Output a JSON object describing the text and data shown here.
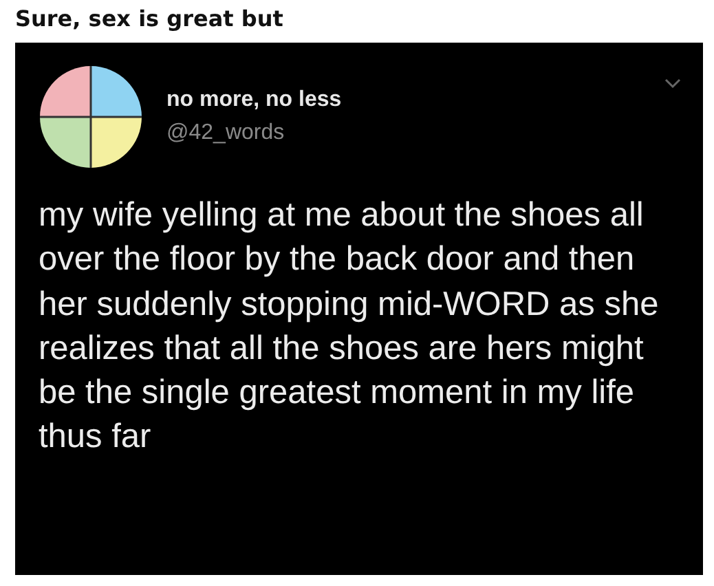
{
  "caption": "Sure, sex is great but",
  "tweet": {
    "display_name": "no more, no less",
    "handle": "@42_words",
    "text": "my wife yelling at me about the shoes all over the floor by the back door and then her suddenly stopping mid-WORD as she realizes that all the shoes are hers might be the single greatest moment in my life thus far"
  }
}
